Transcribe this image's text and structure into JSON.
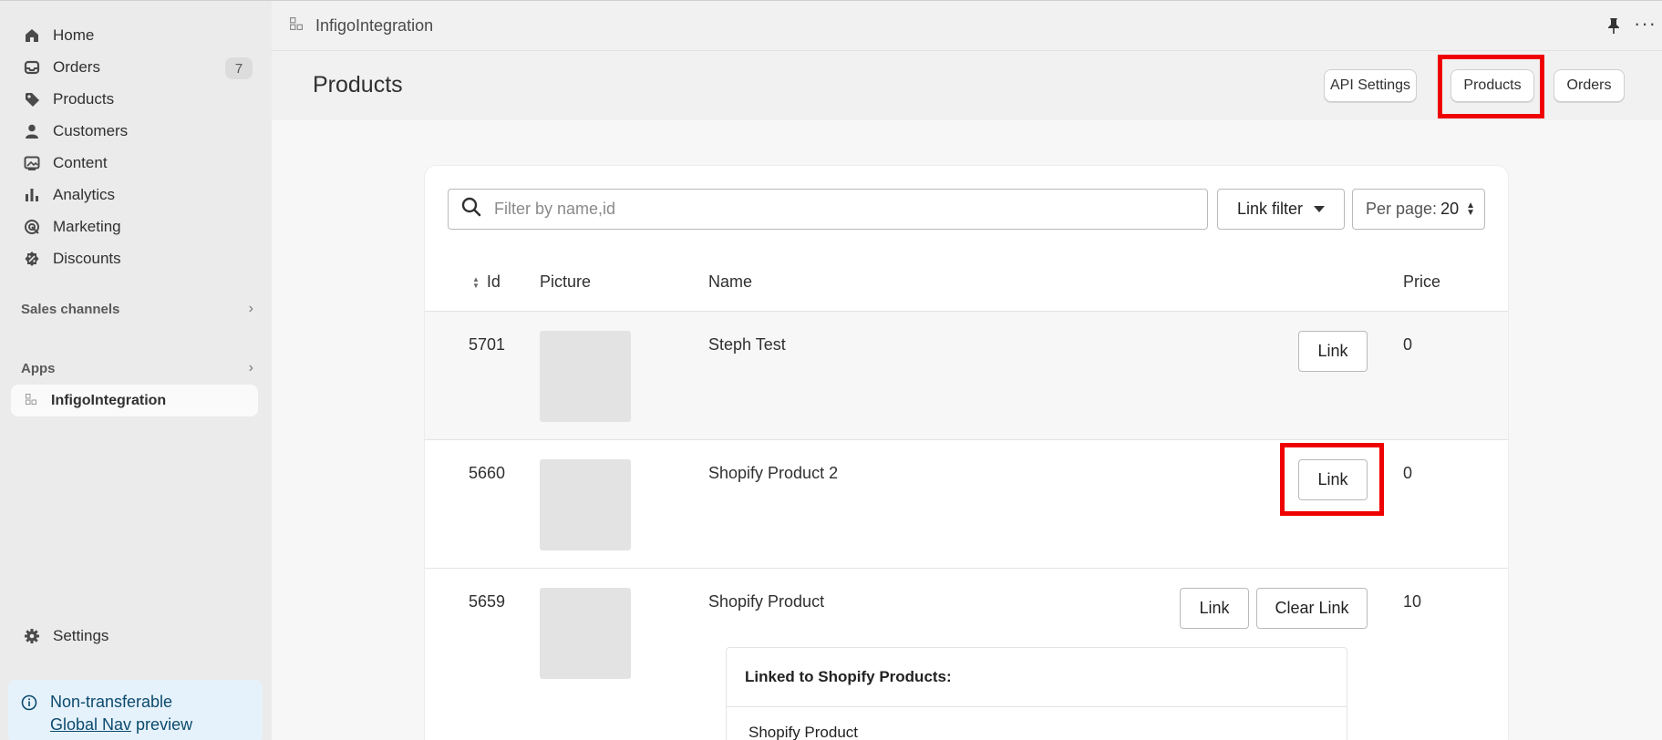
{
  "sidebar": {
    "items": [
      {
        "label": "Home",
        "icon": "home-icon"
      },
      {
        "label": "Orders",
        "icon": "inbox-icon",
        "badge": "7"
      },
      {
        "label": "Products",
        "icon": "tag-icon"
      },
      {
        "label": "Customers",
        "icon": "person-icon"
      },
      {
        "label": "Content",
        "icon": "image-icon"
      },
      {
        "label": "Analytics",
        "icon": "bar-chart-icon"
      },
      {
        "label": "Marketing",
        "icon": "target-icon"
      },
      {
        "label": "Discounts",
        "icon": "discount-icon"
      }
    ],
    "sales_channels": "Sales channels",
    "apps": "Apps",
    "app_item": "InfigoIntegration",
    "settings": "Settings",
    "notice": {
      "line1": "Non-transferable",
      "link": "Global Nav",
      "line2_rest": " preview"
    }
  },
  "topbar": {
    "title": "InfigoIntegration",
    "more": "···"
  },
  "header": {
    "title": "Products",
    "buttons": {
      "api": "API Settings",
      "products": "Products",
      "orders": "Orders"
    }
  },
  "filters": {
    "search_placeholder": "Filter by name,id",
    "link_filter": "Link filter",
    "per_page_label": "Per page:",
    "per_page_value": "20"
  },
  "table": {
    "headers": {
      "id": "Id",
      "picture": "Picture",
      "name": "Name",
      "price": "Price"
    },
    "rows": [
      {
        "id": "5701",
        "name": "Steph Test",
        "price": "0",
        "link": "Link"
      },
      {
        "id": "5660",
        "name": "Shopify Product 2",
        "price": "0",
        "link": "Link"
      },
      {
        "id": "5659",
        "name": "Shopify Product",
        "price": "10",
        "link": "Link",
        "clear": "Clear Link",
        "linked_title": "Linked to Shopify Products:",
        "linked_item": "Shopify Product"
      }
    ]
  },
  "colors": {
    "highlight": "#ee0000",
    "notice_bg": "#e6f2fb",
    "sidebar_bg": "#ebebeb"
  }
}
